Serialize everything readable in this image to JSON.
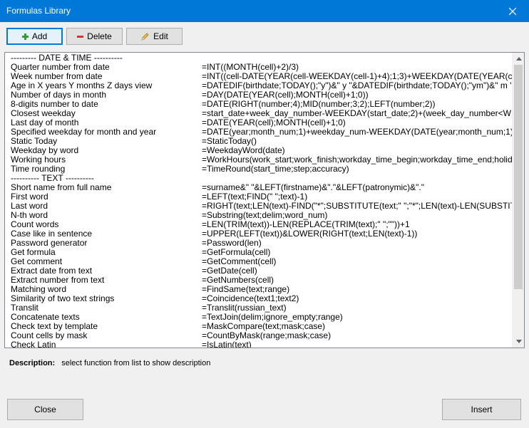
{
  "window": {
    "title": "Formulas Library",
    "close_glyph": "✕"
  },
  "toolbar": {
    "add": {
      "label": "Add",
      "icon": "plus-icon",
      "color": "#2e9d2e"
    },
    "delete": {
      "label": "Delete",
      "icon": "minus-icon",
      "color": "#d93030"
    },
    "edit": {
      "label": "Edit",
      "icon": "pencil-icon"
    }
  },
  "list": {
    "rows": [
      {
        "name": "--------- DATE & TIME ----------",
        "formula": ""
      },
      {
        "name": "Quarter number from date",
        "formula": "=INT((MONTH(cell)+2)/3)"
      },
      {
        "name": "Week number from date",
        "formula": "=INT((cell-DATE(YEAR(cell-WEEKDAY(cell-1)+4);1;3)+WEEKDAY(DATE(YEAR(cell-WEEKDAY"
      },
      {
        "name": "Age in X years Y months Z days view",
        "formula": "=DATEDIF(birthdate;TODAY();\"y\")&\" y \"&DATEDIF(birthdate;TODAY();\"ym\")&\" m \"&DATED"
      },
      {
        "name": "Number of days in month",
        "formula": "=DAY(DATE(YEAR(cell);MONTH(cell)+1;0))"
      },
      {
        "name": "8-digits number to date",
        "formula": "=DATE(RIGHT(number;4);MID(number;3;2);LEFT(number;2))"
      },
      {
        "name": "Closest weekday",
        "formula": "=start_date+week_day_number-WEEKDAY(start_date;2)+(week_day_number<WEEKDA"
      },
      {
        "name": "Last day of month",
        "formula": "=DATE(YEAR(cell);MONTH(cell)+1;0)"
      },
      {
        "name": "Specified weekday for month and year",
        "formula": "=DATE(year;month_num;1)+weekday_num-WEEKDAY(DATE(year;month_num;1);2)+(wee"
      },
      {
        "name": "Static Today",
        "formula": "=StaticToday()"
      },
      {
        "name": "Weekday by word",
        "formula": "=WeekdayWord(date)"
      },
      {
        "name": "Working hours",
        "formula": "=WorkHours(work_start;work_finish;workday_time_begin;workday_time_end;holidays)"
      },
      {
        "name": "Time rounding",
        "formula": "=TimeRound(start_time;step;accuracy)"
      },
      {
        "name": "---------- TEXT ----------",
        "formula": ""
      },
      {
        "name": "Short name from full name",
        "formula": "=surname&\" \"&LEFT(firstname)&\".\"&LEFT(patronymic)&\".\""
      },
      {
        "name": "First word",
        "formula": "=LEFT(text;FIND(\" \";text)-1)"
      },
      {
        "name": "Last word",
        "formula": "=RIGHT(text;LEN(text)-FIND(\"*\";SUBSTITUTE(text;\" \";\"*\";LEN(text)-LEN(SUBSTITUTE(tex"
      },
      {
        "name": "N-th word",
        "formula": "=Substring(text;delim;word_num)"
      },
      {
        "name": "Count words",
        "formula": "=LEN(TRIM(text))-LEN(REPLACE(TRIM(text);\" \";\"\"))+1"
      },
      {
        "name": "Case like in sentence",
        "formula": "=UPPER(LEFT(text))&LOWER(RIGHT(text;LEN(text)-1))"
      },
      {
        "name": "Password generator",
        "formula": "=Password(len)"
      },
      {
        "name": "Get formula",
        "formula": "=GetFormula(cell)"
      },
      {
        "name": "Get comment",
        "formula": "=GetComment(cell)"
      },
      {
        "name": "Extract date from text",
        "formula": "=GetDate(cell)"
      },
      {
        "name": "Extract number from text",
        "formula": "=GetNumbers(cell)"
      },
      {
        "name": "Matching word",
        "formula": "=FindSame(text;range)"
      },
      {
        "name": "Similarity of two text strings",
        "formula": "=Coincidence(text1;text2)"
      },
      {
        "name": "Translit",
        "formula": "=Translit(russian_text)"
      },
      {
        "name": "Concatenate texts",
        "formula": "=TextJoin(delim;ignore_empty;range)"
      },
      {
        "name": "Check text by template",
        "formula": "=MaskCompare(text;mask;case)"
      },
      {
        "name": "Count cells by mask",
        "formula": "=CountByMask(range;mask;case)"
      },
      {
        "name": "Check Latin",
        "formula": "=IsLatin(text)"
      }
    ]
  },
  "description": {
    "label": "Description:",
    "text": "select function from list to show description"
  },
  "footer": {
    "close": "Close",
    "insert": "Insert"
  }
}
